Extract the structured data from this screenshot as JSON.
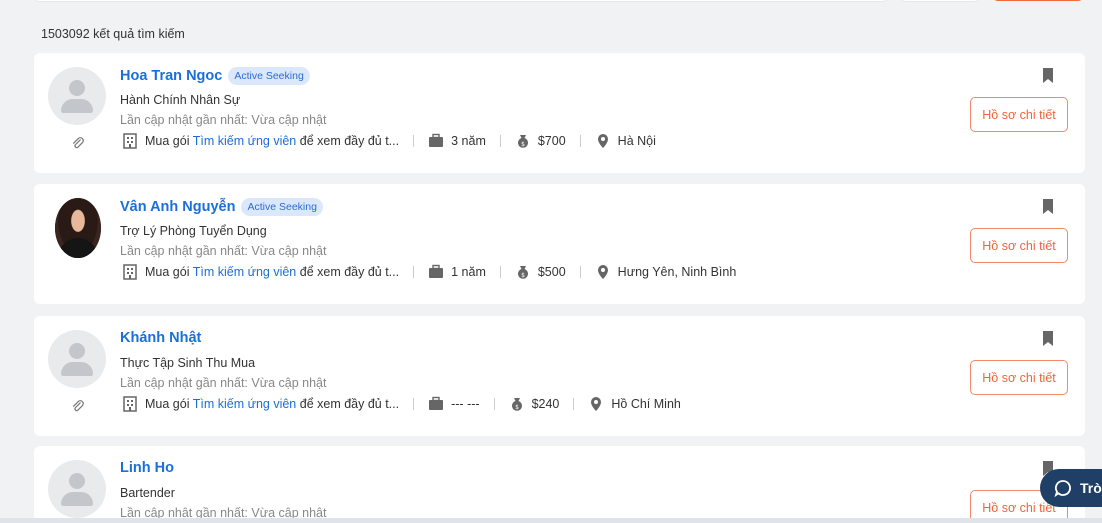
{
  "header": {
    "result_count": "1503092 kết quả tìm kiếm"
  },
  "common": {
    "updated_label": "Lần cập nhật gần nhất: Vừa cập nhật",
    "buy_prefix": "Mua gói ",
    "buy_link": "Tìm kiếm ứng viên",
    "buy_suffix": " để xem đầy đủ t...",
    "detail_button": "Hồ sơ chi tiết",
    "badge": "Active Seeking"
  },
  "candidates": [
    {
      "name": "Hoa Tran Ngoc",
      "badge": "Active Seeking",
      "title": "Hành Chính Nhân Sự",
      "experience": "3 năm",
      "salary": "$700",
      "location": "Hà Nội",
      "has_attachment": true,
      "avatar": "placeholder-avatar"
    },
    {
      "name": "Vân Anh Nguyễn",
      "badge": "Active Seeking",
      "title": "Trợ Lý Phòng Tuyển Dụng",
      "experience": "1 năm",
      "salary": "$500",
      "location": "Hưng Yên, Ninh Bình",
      "has_attachment": false,
      "avatar": "photo-avatar"
    },
    {
      "name": "Khánh Nhật",
      "title": "Thực Tập Sinh Thu Mua",
      "experience": "--- ---",
      "salary": "$240",
      "location": "Hồ Chí Minh",
      "has_attachment": true,
      "avatar": "placeholder-avatar"
    },
    {
      "name": "Linh Ho",
      "title": "Bartender",
      "avatar": "placeholder-avatar"
    }
  ],
  "chat": {
    "label": "Trò"
  },
  "colors": {
    "accent": "#f0643c",
    "link": "#1a6fd8",
    "badge_bg": "#dbe8fb",
    "chat_bg": "#1f3f66"
  }
}
